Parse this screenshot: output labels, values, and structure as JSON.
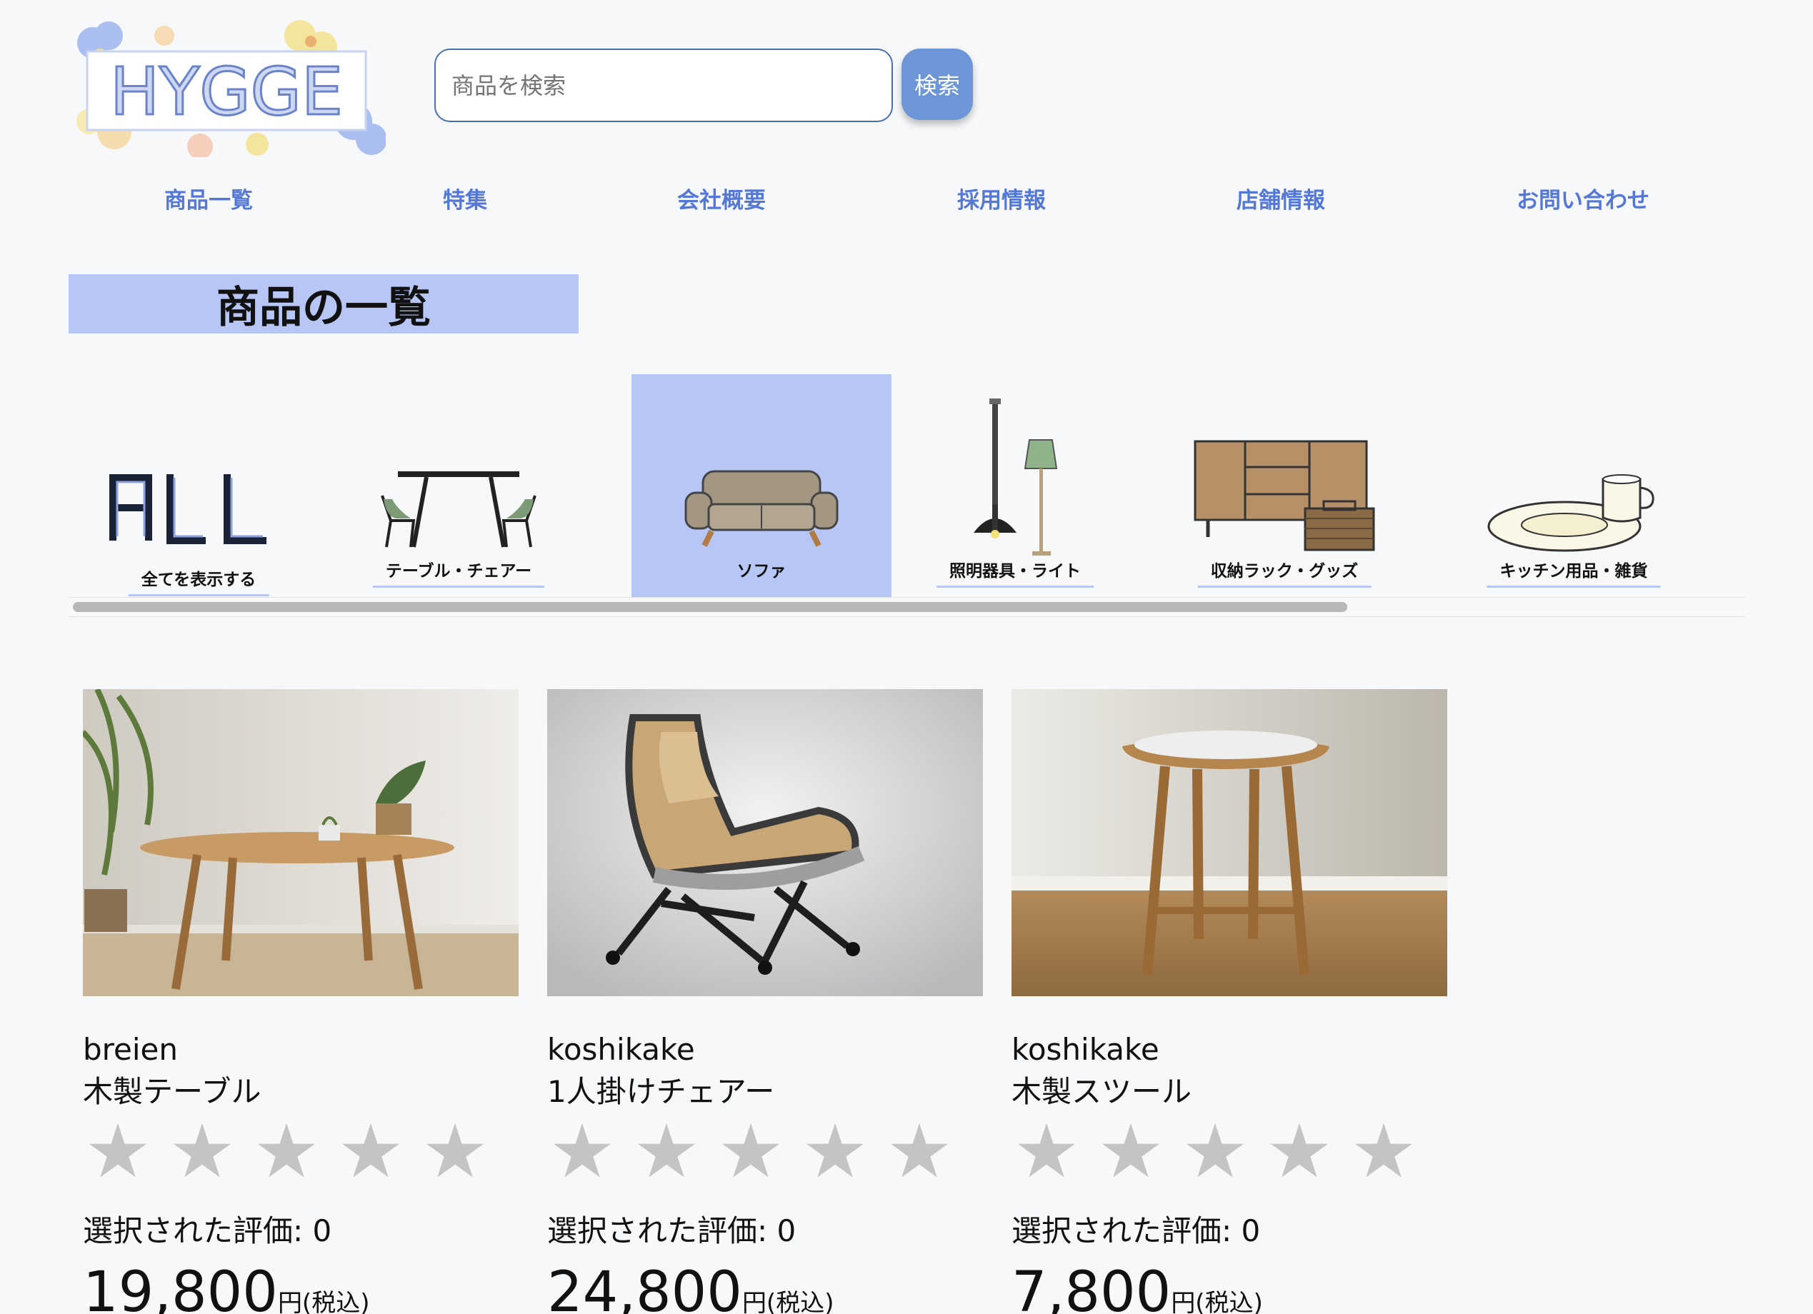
{
  "header": {
    "logo_text": "HYGGE",
    "search_placeholder": "商品を検索",
    "search_button": "検索"
  },
  "nav": [
    {
      "label": "商品一覧"
    },
    {
      "label": "特集"
    },
    {
      "label": "会社概要"
    },
    {
      "label": "採用情報"
    },
    {
      "label": "店舗情報"
    },
    {
      "label": "お問い合わせ"
    }
  ],
  "section_title": "商品の一覧",
  "categories": [
    {
      "label": "全てを表示する",
      "icon": "all-text-icon",
      "selected": false
    },
    {
      "label": "テーブル・チェアー",
      "icon": "table-chair-icon",
      "selected": false
    },
    {
      "label": "ソファ",
      "icon": "sofa-icon",
      "selected": true
    },
    {
      "label": "照明器具・ライト",
      "icon": "lamp-icon",
      "selected": false
    },
    {
      "label": "収納ラック・グッズ",
      "icon": "storage-rack-icon",
      "selected": false
    },
    {
      "label": "キッチン用品・雑貨",
      "icon": "plate-cup-icon",
      "selected": false
    }
  ],
  "colors": {
    "accent": "#b7c6f5",
    "nav_link": "#5578d6",
    "search_button": "#6d96d8",
    "star_inactive": "#c4c4c4"
  },
  "products": [
    {
      "brand": "breien",
      "name": "木製テーブル",
      "stars": [
        "★",
        "★",
        "★",
        "★",
        "★"
      ],
      "rating_text": "選択された評価: 0",
      "rating": 0,
      "price": "19,800",
      "price_unit": "円(税込)"
    },
    {
      "brand": "koshikake",
      "name": "1人掛けチェアー",
      "stars": [
        "★",
        "★",
        "★",
        "★",
        "★"
      ],
      "rating_text": "選択された評価: 0",
      "rating": 0,
      "price": "24,800",
      "price_unit": "円(税込)"
    },
    {
      "brand": "koshikake",
      "name": "木製スツール",
      "stars": [
        "★",
        "★",
        "★",
        "★",
        "★"
      ],
      "rating_text": "選択された評価: 0",
      "rating": 0,
      "price": "7,800",
      "price_unit": "円(税込)"
    }
  ]
}
